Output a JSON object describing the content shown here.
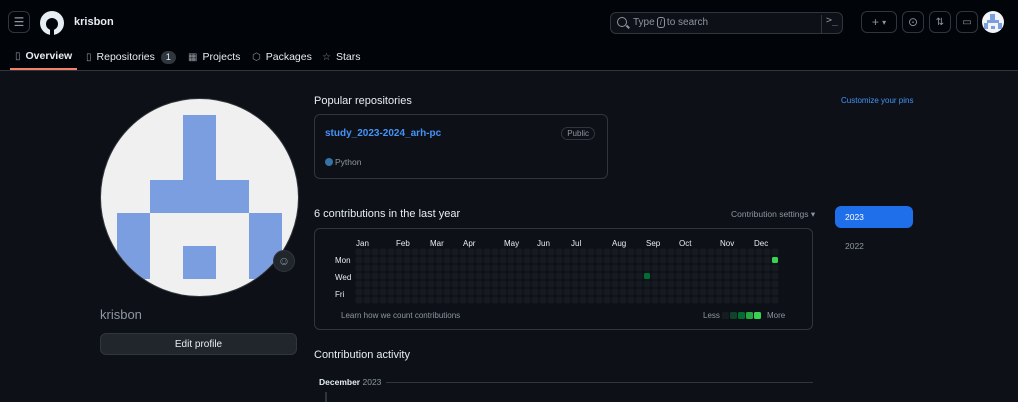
{
  "header": {
    "username": "krisbon",
    "search_placeholder_pre": "Type",
    "search_key": "/",
    "search_placeholder_post": "to search",
    "command_icon": "terminal-icon",
    "plus_label": "+",
    "chevron": "▾"
  },
  "nav": {
    "tabs": [
      {
        "label": "Overview",
        "icon": "book-icon"
      },
      {
        "label": "Repositories",
        "icon": "repo-icon",
        "count": "1"
      },
      {
        "label": "Projects",
        "icon": "table-icon"
      },
      {
        "label": "Packages",
        "icon": "package-icon"
      },
      {
        "label": "Stars",
        "icon": "star-icon"
      }
    ]
  },
  "profile": {
    "name": "krisbon",
    "edit_label": "Edit profile"
  },
  "popular": {
    "title": "Popular repositories",
    "customize": "Customize your pins",
    "repo": {
      "name": "study_2023-2024_arh-pc",
      "visibility": "Public",
      "language": "Python",
      "language_color": "#3572a5"
    }
  },
  "contributions": {
    "title": "6 contributions in the last year",
    "settings_label": "Contribution settings ▾",
    "months": [
      "Jan",
      "Feb",
      "Mar",
      "Apr",
      "May",
      "Jun",
      "Jul",
      "Aug",
      "Sep",
      "Oct",
      "Nov",
      "Dec"
    ],
    "day_labels": [
      "Mon",
      "Wed",
      "Fri"
    ],
    "learn_label": "Learn how we count contributions",
    "less_label": "Less",
    "more_label": "More",
    "weeks": 53,
    "active_cells": [
      {
        "week": 36,
        "day": 3,
        "level": 2
      },
      {
        "week": 52,
        "day": 1,
        "level": 4
      }
    ],
    "level_colors": [
      "#161b22",
      "#0e4429",
      "#006d32",
      "#26a641",
      "#39d353"
    ]
  },
  "years": [
    "2023",
    "2022"
  ],
  "activity": {
    "title": "Contribution activity",
    "month": "December",
    "year": "2023"
  }
}
